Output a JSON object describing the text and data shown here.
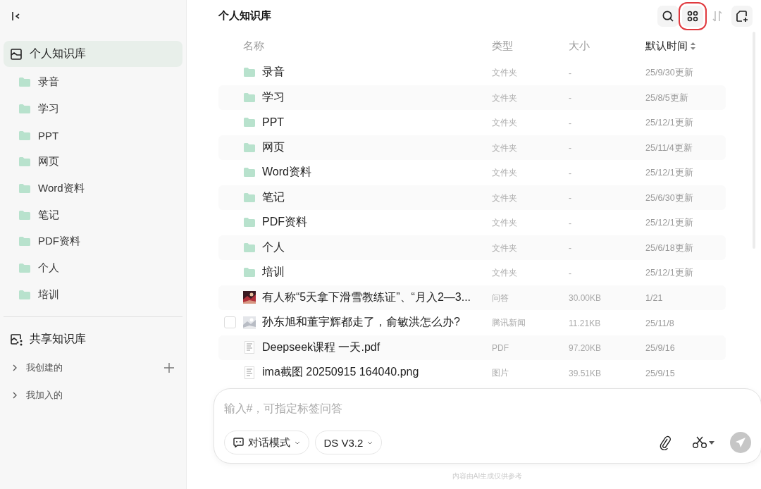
{
  "sidebar": {
    "personal_kb": {
      "label": "个人知识库",
      "selected": true
    },
    "folders": [
      {
        "label": "录音"
      },
      {
        "label": "学习"
      },
      {
        "label": "PPT"
      },
      {
        "label": "网页"
      },
      {
        "label": "Word资料"
      },
      {
        "label": "笔记"
      },
      {
        "label": "PDF资料"
      },
      {
        "label": "个人"
      },
      {
        "label": "培训"
      }
    ],
    "shared_kb": {
      "label": "共享知识库",
      "selected": false
    },
    "groups": [
      {
        "label": "我创建的",
        "expanded": false,
        "can_add": true
      },
      {
        "label": "我加入的",
        "expanded": false,
        "can_add": false
      }
    ]
  },
  "main": {
    "title": "个人知识库",
    "toolbar": [
      {
        "kind": "search",
        "highlighted": false,
        "disabled": false
      },
      {
        "kind": "grid",
        "highlighted": true,
        "disabled": false
      },
      {
        "kind": "sort",
        "highlighted": false,
        "disabled": true
      },
      {
        "kind": "new",
        "highlighted": false,
        "disabled": false
      }
    ],
    "table": {
      "columns": [
        {
          "label": "名称",
          "sorted": false
        },
        {
          "label": "类型",
          "sorted": false
        },
        {
          "label": "大小",
          "sorted": false
        },
        {
          "label": "默认时间",
          "sorted": true
        }
      ],
      "rows": [
        {
          "kind": "folder",
          "name": "录音",
          "type": "文件夹",
          "size": "-",
          "time": "25/9/30更新",
          "hovered": false
        },
        {
          "kind": "folder",
          "name": "学习",
          "type": "文件夹",
          "size": "-",
          "time": "25/8/5更新",
          "hovered": false
        },
        {
          "kind": "folder",
          "name": "PPT",
          "type": "文件夹",
          "size": "-",
          "time": "25/12/1更新",
          "hovered": false
        },
        {
          "kind": "folder",
          "name": "网页",
          "type": "文件夹",
          "size": "-",
          "time": "25/11/4更新",
          "hovered": false
        },
        {
          "kind": "folder",
          "name": "Word资料",
          "type": "文件夹",
          "size": "-",
          "time": "25/12/1更新",
          "hovered": false
        },
        {
          "kind": "folder",
          "name": "笔记",
          "type": "文件夹",
          "size": "-",
          "time": "25/6/30更新",
          "hovered": false
        },
        {
          "kind": "folder",
          "name": "PDF资料",
          "type": "文件夹",
          "size": "-",
          "time": "25/12/1更新",
          "hovered": false
        },
        {
          "kind": "folder",
          "name": "个人",
          "type": "文件夹",
          "size": "-",
          "time": "25/6/18更新",
          "hovered": false
        },
        {
          "kind": "folder",
          "name": "培训",
          "type": "文件夹",
          "size": "-",
          "time": "25/12/1更新",
          "hovered": false
        },
        {
          "name": "有人称“5天拿下滑雪教练证”、“月入2—3...",
          "type": "问答",
          "size": "30.00KB",
          "time": "1/21",
          "hovered": false
        },
        {
          "name": "孙东旭和董宇辉都走了，俞敏洪怎么办?",
          "type": "腾讯新闻",
          "size": "11.21KB",
          "time": "25/11/8",
          "hovered": true
        },
        {
          "kind": "document",
          "name": "Deepseek课程 一天.pdf",
          "type": "PDF",
          "size": "97.20KB",
          "time": "25/9/16",
          "hovered": false
        },
        {
          "kind": "document",
          "name": "ima截图 20250915 164040.png",
          "type": "图片",
          "size": "39.51KB",
          "time": "25/9/15",
          "hovered": false
        }
      ]
    }
  },
  "composer": {
    "placeholder": "输入#，可指定标签问答",
    "mode": "对话模式",
    "model": "DS V3.2",
    "send_enabled": false
  },
  "footer_note": "内容由AI生成仅供参考"
}
